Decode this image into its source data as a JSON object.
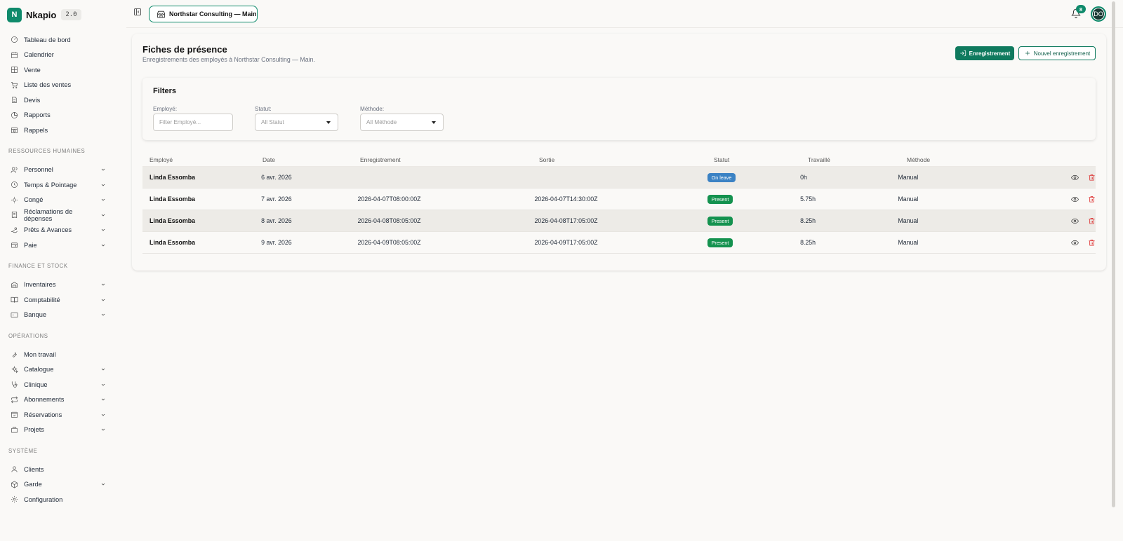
{
  "brand": {
    "name": "Nkapio",
    "version": "2.0",
    "logo_letter": "N",
    "accent": "#0f8a6b"
  },
  "sidebar": {
    "top_items": [
      {
        "label": "Tableau de bord",
        "icon": "dashboard-icon"
      },
      {
        "label": "Calendrier",
        "icon": "calendar-icon"
      },
      {
        "label": "Vente",
        "icon": "grid-icon"
      },
      {
        "label": "Liste des ventes",
        "icon": "cart-icon"
      },
      {
        "label": "Devis",
        "icon": "document-icon"
      },
      {
        "label": "Rapports",
        "icon": "pie-chart-icon"
      },
      {
        "label": "Rappels",
        "icon": "calendar-clock-icon"
      }
    ],
    "sections": [
      {
        "label": "RESSOURCES HUMAINES",
        "items": [
          {
            "label": "Personnel",
            "icon": "users-icon"
          },
          {
            "label": "Temps & Pointage",
            "icon": "clock-icon"
          },
          {
            "label": "Congé",
            "icon": "sun-icon"
          },
          {
            "label": "Réclamations de dépenses",
            "icon": "receipt-icon"
          },
          {
            "label": "Prêts & Avances",
            "icon": "hand-coins-icon"
          },
          {
            "label": "Paie",
            "icon": "wallet-icon"
          }
        ]
      },
      {
        "label": "FINANCE ET STOCK",
        "items": [
          {
            "label": "Inventaires",
            "icon": "warehouse-icon"
          },
          {
            "label": "Comptabilité",
            "icon": "book-icon"
          },
          {
            "label": "Banque",
            "icon": "bank-card-icon"
          }
        ]
      },
      {
        "label": "OPÉRATIONS",
        "items": [
          {
            "label": "Mon travail",
            "icon": "wrench-icon",
            "no_chevron": true
          },
          {
            "label": "Catalogue",
            "icon": "sparkles-icon"
          },
          {
            "label": "Clinique",
            "icon": "stethoscope-icon"
          },
          {
            "label": "Abonnements",
            "icon": "repeat-icon"
          },
          {
            "label": "Réservations",
            "icon": "calendar-check-icon"
          },
          {
            "label": "Projets",
            "icon": "briefcase-icon"
          }
        ]
      },
      {
        "label": "SYSTÈME",
        "items": [
          {
            "label": "Clients",
            "icon": "user-icon",
            "no_chevron": true
          },
          {
            "label": "Garde",
            "icon": "box-icon"
          },
          {
            "label": "Configuration",
            "icon": "gear-icon",
            "no_chevron": true
          }
        ]
      }
    ]
  },
  "topbar": {
    "store_name": "Northstar Consulting — Main",
    "notifications_count": "8",
    "avatar_initials": "DO"
  },
  "page": {
    "title": "Fiches de présence",
    "subtitle": "Enregistrements des employés à Northstar Consulting — Main.",
    "primary_button": "Enregistrement",
    "secondary_button": "Nouvel enregistrement"
  },
  "filters": {
    "title": "Filters",
    "employee": {
      "label": "Employé:",
      "placeholder": "Filter Employé..."
    },
    "status": {
      "label": "Statut:",
      "value": "All Statut"
    },
    "method": {
      "label": "Méthode:",
      "value": "All Méthode"
    }
  },
  "table": {
    "headers": [
      "Employé",
      "Date",
      "Enregistrement",
      "Sortie",
      "Statut",
      "Travaillé",
      "Méthode"
    ],
    "rows": [
      {
        "employee": "Linda Essomba",
        "date": "6 avr. 2026",
        "check_in": "",
        "check_out": "",
        "status": "On leave",
        "status_kind": "leave",
        "worked": "0h",
        "method": "Manual"
      },
      {
        "employee": "Linda Essomba",
        "date": "7 avr. 2026",
        "check_in": "2026-04-07T08:00:00Z",
        "check_out": "2026-04-07T14:30:00Z",
        "status": "Present",
        "status_kind": "present",
        "worked": "5.75h",
        "method": "Manual"
      },
      {
        "employee": "Linda Essomba",
        "date": "8 avr. 2026",
        "check_in": "2026-04-08T08:05:00Z",
        "check_out": "2026-04-08T17:05:00Z",
        "status": "Present",
        "status_kind": "present",
        "worked": "8.25h",
        "method": "Manual"
      },
      {
        "employee": "Linda Essomba",
        "date": "9 avr. 2026",
        "check_in": "2026-04-09T08:05:00Z",
        "check_out": "2026-04-09T17:05:00Z",
        "status": "Present",
        "status_kind": "present",
        "worked": "8.25h",
        "method": "Manual"
      }
    ]
  }
}
